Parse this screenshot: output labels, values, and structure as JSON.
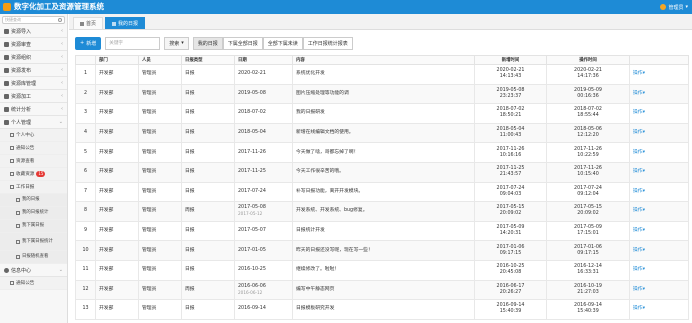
{
  "app": {
    "title": "数字化加工及资源管理系统",
    "user": "管理员"
  },
  "sidebar": {
    "search_placeholder": "快捷查询",
    "items": [
      {
        "label": "资源导入",
        "icon": "import-icon"
      },
      {
        "label": "资源审查",
        "icon": "review-icon"
      },
      {
        "label": "资源组织",
        "icon": "star-icon"
      },
      {
        "label": "资源发布",
        "icon": "folder-icon"
      },
      {
        "label": "资源库管理",
        "icon": "database-icon"
      },
      {
        "label": "资源加工",
        "icon": "image-icon"
      },
      {
        "label": "统计分析",
        "icon": "chart-icon"
      },
      {
        "label": "个人管理",
        "icon": "monitor-icon"
      }
    ],
    "personal": {
      "center": "个人中心",
      "notice": "通知公告",
      "view": "资源查看",
      "favorites": "收藏资源",
      "favorites_badge": "15",
      "work_log": "工作日报",
      "log_items": [
        "我的日报",
        "我的日报统计",
        "我下属日报",
        "我下属日报统计",
        "日报随机查看"
      ]
    },
    "info_center": "信息中心",
    "info_notice": "通知公告"
  },
  "tabs": [
    {
      "label": "首页"
    },
    {
      "label": "我的日报"
    }
  ],
  "toolbar": {
    "new_label": "新增",
    "keyword_placeholder": "关键字",
    "search_label": "搜索",
    "filters": [
      "我的日报",
      "下属全部日报",
      "全部下属未读",
      "工作日报统计报表"
    ]
  },
  "table": {
    "columns": [
      "",
      "部门",
      "人员",
      "日报类型",
      "日期",
      "内容",
      "新增时间",
      "操作时间",
      ""
    ],
    "rows": [
      {
        "no": "1",
        "dept": "开发部",
        "person": "管理员",
        "type": "日报",
        "date": "2020-02-21",
        "date_sub": "",
        "content": "系统优化开发",
        "created": "2020-02-21",
        "created_t": "14:13:43",
        "op": "2020-02-21",
        "op_t": "14:17:36",
        "action": "操作"
      },
      {
        "no": "2",
        "dept": "开发部",
        "person": "管理员",
        "type": "日报",
        "date": "2019-05-08",
        "date_sub": "",
        "content": "图片压缩处理等功能的调",
        "created": "2019-05-08",
        "created_t": "23:23:37",
        "op": "2019-05-09",
        "op_t": "00:16:36",
        "action": "操作"
      },
      {
        "no": "3",
        "dept": "开发部",
        "person": "管理员",
        "type": "日报",
        "date": "2018-07-02",
        "date_sub": "",
        "content": "我的日报研发",
        "created": "2018-07-02",
        "created_t": "18:50:21",
        "op": "2018-07-02",
        "op_t": "18:55:44",
        "action": "操作"
      },
      {
        "no": "4",
        "dept": "开发部",
        "person": "管理员",
        "type": "日报",
        "date": "2018-05-04",
        "date_sub": "",
        "content": "新增在线编辑文档的使用。",
        "created": "2018-05-04",
        "created_t": "11:00:43",
        "op": "2018-05-06",
        "op_t": "12:12:20",
        "action": "操作"
      },
      {
        "no": "5",
        "dept": "开发部",
        "person": "管理员",
        "type": "日报",
        "date": "2017-11-26",
        "date_sub": "",
        "content": "今天做了啥，哥都忘掉了啊！",
        "created": "2017-11-26",
        "created_t": "10:16:16",
        "op": "2017-11-26",
        "op_t": "10:22:59",
        "action": "操作"
      },
      {
        "no": "6",
        "dept": "开发部",
        "person": "管理员",
        "type": "日报",
        "date": "2017-11-25",
        "date_sub": "",
        "content": "今天工作很辛苦的哦。",
        "created": "2017-11-25",
        "created_t": "21:43:57",
        "op": "2017-11-26",
        "op_t": "10:15:40",
        "action": "操作"
      },
      {
        "no": "7",
        "dept": "开发部",
        "person": "管理员",
        "type": "日报",
        "date": "2017-07-24",
        "date_sub": "",
        "content": "补写日报功能，离开开发模块。",
        "created": "2017-07-24",
        "created_t": "09:04:03",
        "op": "2017-07-24",
        "op_t": "09:12:04",
        "action": "操作"
      },
      {
        "no": "8",
        "dept": "开发部",
        "person": "管理员",
        "type": "周报",
        "date": "2017-05-08",
        "date_sub": "2017-05-12",
        "content": "开发系统、开发系统、bug修复。",
        "created": "2017-05-15",
        "created_t": "20:09:02",
        "op": "2017-05-15",
        "op_t": "20:09:02",
        "action": "操作"
      },
      {
        "no": "9",
        "dept": "开发部",
        "person": "管理员",
        "type": "日报",
        "date": "2017-05-07",
        "date_sub": "",
        "content": "日报统计开发",
        "created": "2017-05-09",
        "created_t": "14:20:31",
        "op": "2017-05-09",
        "op_t": "17:15:01",
        "action": "操作"
      },
      {
        "no": "10",
        "dept": "开发部",
        "person": "管理员",
        "type": "日报",
        "date": "2017-01-05",
        "date_sub": "",
        "content": "昨天的日报还没写呢，现在写一些！",
        "created": "2017-01-06",
        "created_t": "09:17:15",
        "op": "2017-01-06",
        "op_t": "09:17:15",
        "action": "操作"
      },
      {
        "no": "11",
        "dept": "开发部",
        "person": "管理员",
        "type": "日报",
        "date": "2016-10-25",
        "date_sub": "",
        "content": "继续修改了。啦啦！",
        "created": "2016-10-25",
        "created_t": "20:45:08",
        "op": "2016-12-14",
        "op_t": "16:33:31",
        "action": "操作"
      },
      {
        "no": "12",
        "dept": "开发部",
        "person": "管理员",
        "type": "周报",
        "date": "2016-06-06",
        "date_sub": "2016-06-12",
        "content": "编写中午静态网页",
        "created": "2016-06-17",
        "created_t": "20:26:27",
        "op": "2016-10-19",
        "op_t": "21:27:03",
        "action": "操作"
      },
      {
        "no": "13",
        "dept": "开发部",
        "person": "管理员",
        "type": "日报",
        "date": "2016-09-14",
        "date_sub": "",
        "content": "日报模板研究开发",
        "created": "2016-09-14",
        "created_t": "15:40:39",
        "op": "2016-09-14",
        "op_t": "15:40:39",
        "action": "操作"
      }
    ]
  }
}
